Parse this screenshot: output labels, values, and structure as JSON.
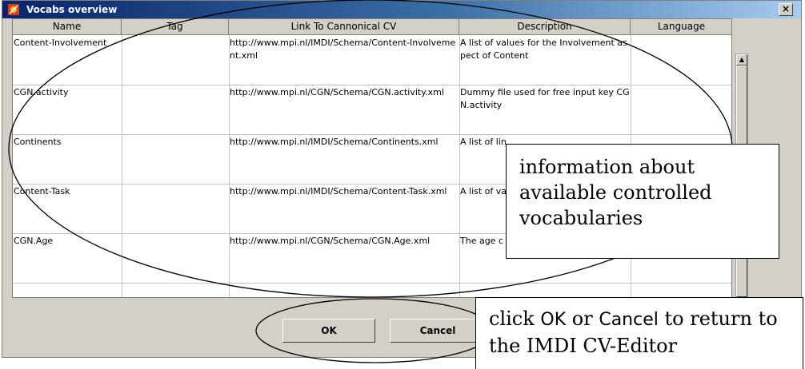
{
  "window": {
    "title": "Vocabs overview",
    "close_glyph": "×"
  },
  "table": {
    "columns": [
      "Name",
      "Tag",
      "Link To Cannonical CV",
      "Description",
      "Language"
    ],
    "rows": [
      [
        "Content-Involvement",
        "",
        "http://www.mpi.nl/IMDI/Schema/Content-Involvement.xml",
        "A list of values for the Involvement aspect of Content",
        ""
      ],
      [
        "CGN.activity",
        "",
        "http://www.mpi.nl/CGN/Schema/CGN.activity.xml",
        "Dummy file used for free input key CGN.activity",
        ""
      ],
      [
        "Continents",
        "",
        "http://www.mpi.nl/IMDI/Schema/Continents.xml",
        "A list of lin",
        ""
      ],
      [
        "Content-Task",
        "",
        "http://www.mpi.nl/IMDI/Schema/Content-Task.xml",
        "A list of va aspect of",
        ""
      ],
      [
        "CGN.Age",
        "",
        "http://www.mpi.nl/CGN/Schema/CGN.Age.xml",
        "The age c CGN corpus",
        ""
      ]
    ]
  },
  "buttons": {
    "ok": "OK",
    "cancel": "Cancel"
  },
  "scroll": {
    "up": "▲",
    "down": "▼"
  },
  "callouts": {
    "info": "information about available controlled vocabularies",
    "click_pre": "click ",
    "click_ok": "OK",
    "click_or": " or ",
    "click_cancel": "Cancel",
    "click_post": " to return to the IMDI CV-Editor"
  },
  "colors": {
    "titlebar_start": "#0a246a",
    "titlebar_end": "#a6caf0",
    "dialog_bg": "#d4d0c8"
  }
}
